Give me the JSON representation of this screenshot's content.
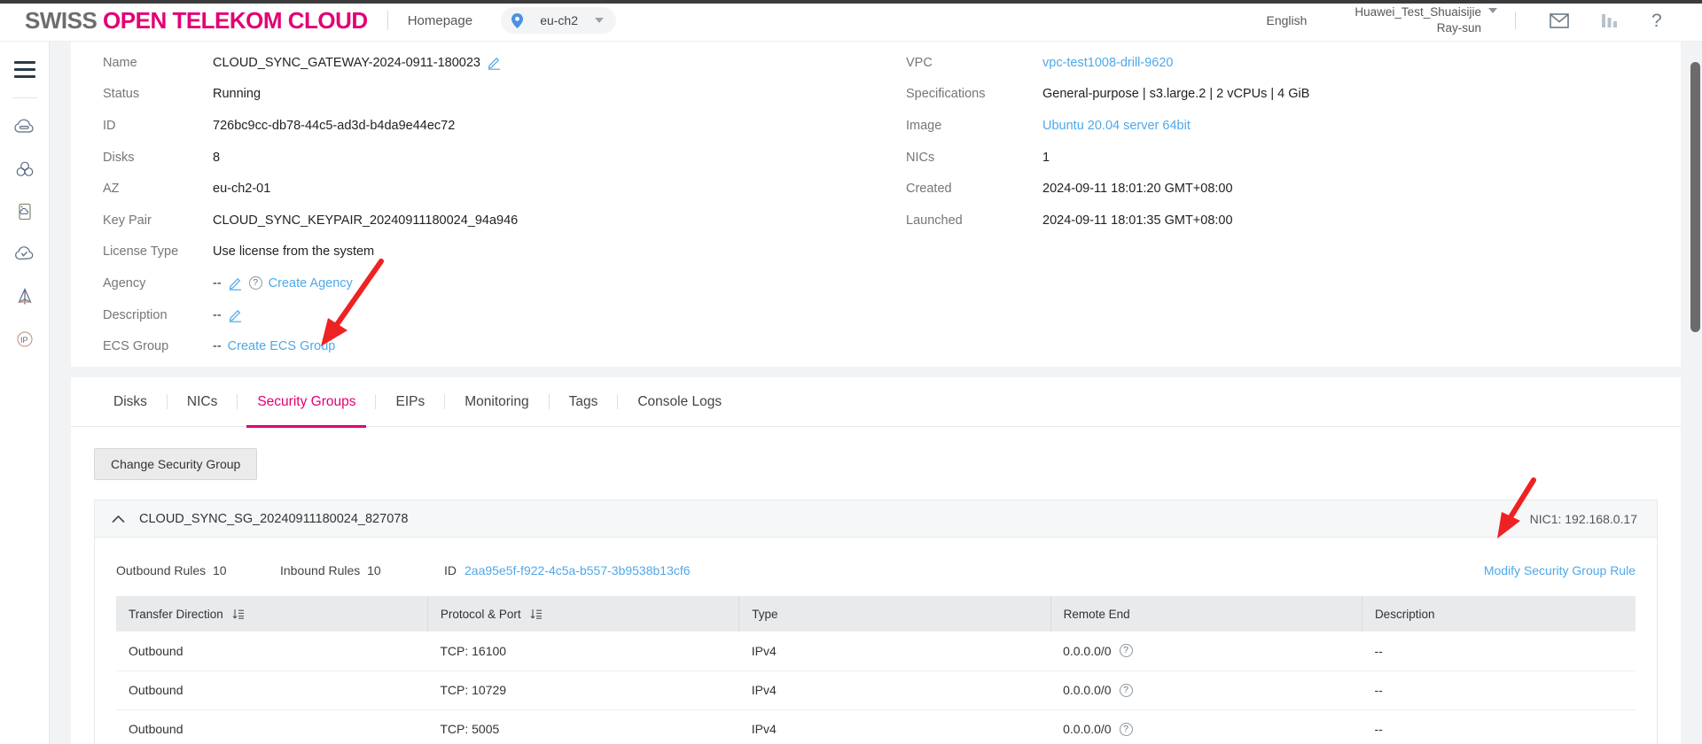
{
  "header": {
    "brand_part1": "SWISS",
    "brand_part2": "OPEN TELEKOM CLOUD",
    "homepage": "Homepage",
    "region": "eu-ch2",
    "language": "English",
    "account_line1": "Huawei_Test_Shuaisijie",
    "account_line2": "Ray-sun",
    "icons": {
      "mail": "mail-icon",
      "stats": "bar-chart-icon",
      "help": "question-mark-icon"
    }
  },
  "rail": {
    "menu": "hamburger-menu",
    "items": [
      {
        "name": "cloud-server-icon"
      },
      {
        "name": "cloud-cluster-icon"
      },
      {
        "name": "cloud-storage-icon"
      },
      {
        "name": "cloud-check-icon"
      },
      {
        "name": "cloud-network-icon"
      },
      {
        "name": "elastic-ip-icon",
        "text": "IP"
      }
    ]
  },
  "detail": {
    "left": [
      {
        "label": "Name",
        "value": "CLOUD_SYNC_GATEWAY-2024-0911-180023",
        "edit": true
      },
      {
        "label": "Status",
        "value": "Running"
      },
      {
        "label": "ID",
        "value": "726bc9cc-db78-44c5-ad3d-b4da9e44ec72"
      },
      {
        "label": "Disks",
        "value": "8"
      },
      {
        "label": "AZ",
        "value": "eu-ch2-01"
      },
      {
        "label": "Key Pair",
        "value": "CLOUD_SYNC_KEYPAIR_20240911180024_94a946"
      },
      {
        "label": "License Type",
        "value": "Use license from the system"
      },
      {
        "label": "Agency",
        "value": "--",
        "edit": true,
        "help": true,
        "link": "Create Agency"
      },
      {
        "label": "Description",
        "value": "--",
        "edit": true
      },
      {
        "label": "ECS Group",
        "value": "--",
        "link": "Create ECS Group"
      }
    ],
    "right": [
      {
        "label": "VPC",
        "value": "vpc-test1008-drill-9620",
        "isLink": true
      },
      {
        "label": "Specifications",
        "value": "General-purpose | s3.large.2 | 2 vCPUs | 4 GiB"
      },
      {
        "label": "Image",
        "value": "Ubuntu 20.04 server 64bit",
        "isLink": true
      },
      {
        "label": "NICs",
        "value": "1"
      },
      {
        "label": "Created",
        "value": "2024-09-11 18:01:20 GMT+08:00"
      },
      {
        "label": "Launched",
        "value": "2024-09-11 18:01:35 GMT+08:00"
      }
    ]
  },
  "tabs": [
    {
      "label": "Disks",
      "active": false
    },
    {
      "label": "NICs",
      "active": false
    },
    {
      "label": "Security Groups",
      "active": true
    },
    {
      "label": "EIPs",
      "active": false
    },
    {
      "label": "Monitoring",
      "active": false
    },
    {
      "label": "Tags",
      "active": false
    },
    {
      "label": "Console Logs",
      "active": false
    }
  ],
  "security": {
    "change_button": "Change Security Group",
    "group_name": "CLOUD_SYNC_SG_20240911180024_827078",
    "nic_label": "NIC1: 192.168.0.17",
    "outbound_label": "Outbound Rules",
    "outbound_count": "10",
    "inbound_label": "Inbound Rules",
    "inbound_count": "10",
    "id_label": "ID",
    "id_value": "2aa95e5f-f922-4c5a-b557-3b9538b13cf6",
    "modify_link": "Modify Security Group Rule",
    "columns": [
      {
        "label": "Transfer Direction",
        "sortable": true
      },
      {
        "label": "Protocol & Port",
        "sortable": true
      },
      {
        "label": "Type",
        "sortable": false
      },
      {
        "label": "Remote End",
        "sortable": false
      },
      {
        "label": "Description",
        "sortable": false
      }
    ],
    "rows": [
      {
        "direction": "Outbound",
        "protocol": "TCP: 16100",
        "type": "IPv4",
        "remote": "0.0.0.0/0",
        "description": "--"
      },
      {
        "direction": "Outbound",
        "protocol": "TCP: 10729",
        "type": "IPv4",
        "remote": "0.0.0.0/0",
        "description": "--"
      },
      {
        "direction": "Outbound",
        "protocol": "TCP: 5005",
        "type": "IPv4",
        "remote": "0.0.0.0/0",
        "description": "--"
      }
    ]
  },
  "colors": {
    "accent": "#e20074",
    "link": "#4fa8e8",
    "annotation": "#ee2222"
  }
}
